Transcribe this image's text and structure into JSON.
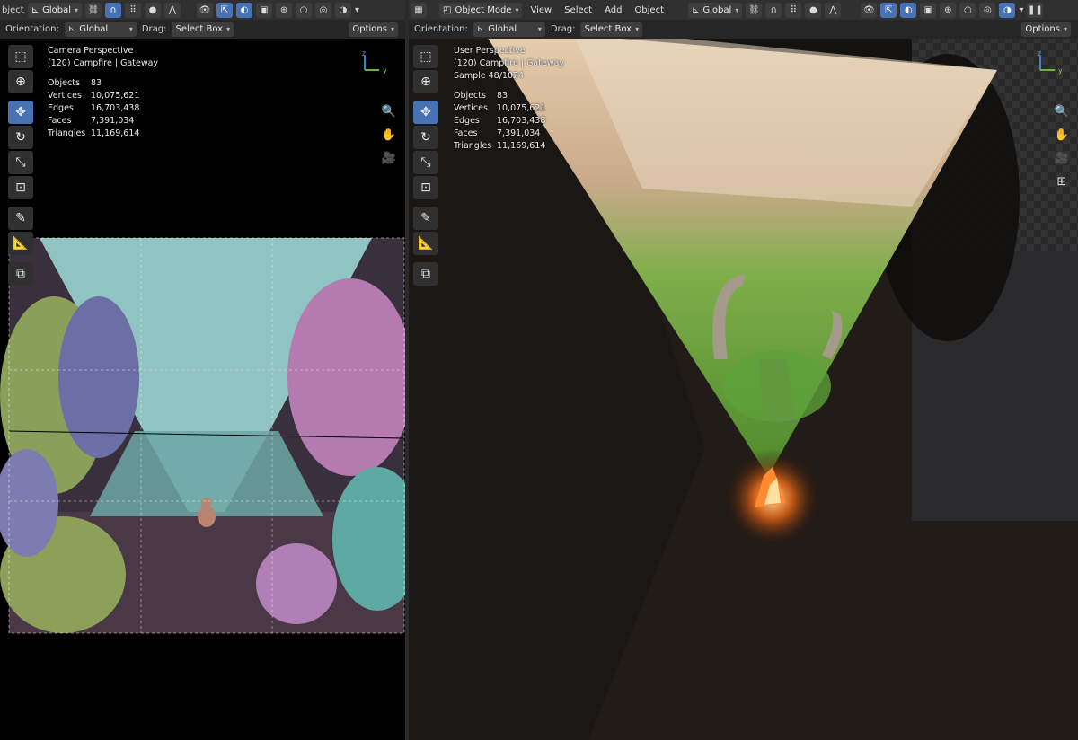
{
  "left": {
    "header": {
      "mode_label": "bject",
      "transform_orientation": "Global",
      "orientation_label": "Orientation:",
      "orientation_value": "Global",
      "drag_label": "Drag:",
      "drag_value": "Select Box",
      "options_label": "Options"
    },
    "overlay": {
      "view_name": "Camera Perspective",
      "collection": "(120) Campfire | Gateway"
    },
    "stats": [
      {
        "key": "Objects",
        "value": "83"
      },
      {
        "key": "Vertices",
        "value": "10,075,621"
      },
      {
        "key": "Edges",
        "value": "16,703,438"
      },
      {
        "key": "Faces",
        "value": "7,391,034"
      },
      {
        "key": "Triangles",
        "value": "11,169,614"
      }
    ]
  },
  "right": {
    "header": {
      "mode_label": "Object Mode",
      "menus": [
        "View",
        "Select",
        "Add",
        "Object"
      ],
      "transform_orientation": "Global",
      "orientation_label": "Orientation:",
      "orientation_value": "Global",
      "drag_label": "Drag:",
      "drag_value": "Select Box",
      "options_label": "Options"
    },
    "overlay": {
      "view_name": "User Perspective",
      "collection": "(120) Campfire | Gateway",
      "sample": "Sample 48/1024"
    },
    "stats": [
      {
        "key": "Objects",
        "value": "83"
      },
      {
        "key": "Vertices",
        "value": "10,075,621"
      },
      {
        "key": "Edges",
        "value": "16,703,438"
      },
      {
        "key": "Faces",
        "value": "7,391,034"
      },
      {
        "key": "Triangles",
        "value": "11,169,614"
      }
    ]
  },
  "tools": [
    "select-box",
    "cursor",
    "move",
    "rotate",
    "scale",
    "transform",
    "annotate",
    "measure",
    "add-cube"
  ],
  "colors": {
    "active_blue": "#4772b3",
    "header_bg": "#303030",
    "beam_cyan": "#8fc4c2"
  }
}
